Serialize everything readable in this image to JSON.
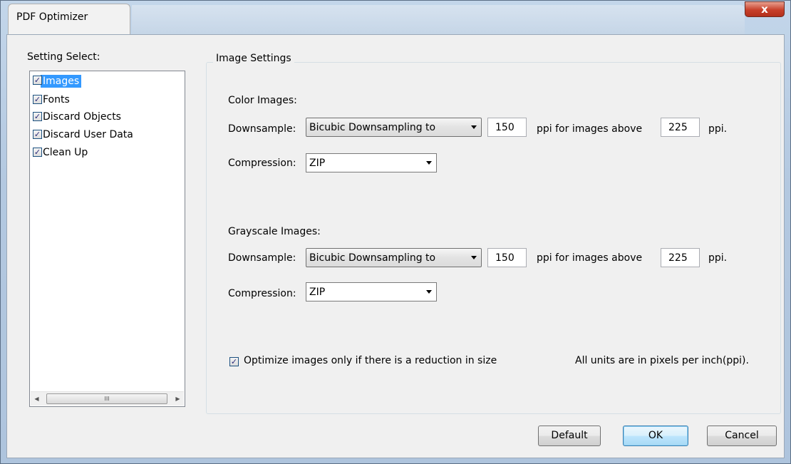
{
  "window": {
    "title": "PDF Optimizer",
    "close_symbol": "x"
  },
  "settings": {
    "header": "Setting Select:",
    "items": [
      {
        "label": "Images",
        "checked": true,
        "selected": true
      },
      {
        "label": "Fonts",
        "checked": true,
        "selected": false
      },
      {
        "label": "Discard Objects",
        "checked": true,
        "selected": false
      },
      {
        "label": "Discard User Data",
        "checked": true,
        "selected": false
      },
      {
        "label": "Clean Up",
        "checked": true,
        "selected": false
      }
    ],
    "scroll_grip": "III"
  },
  "image_settings": {
    "title": "Image Settings",
    "color": {
      "heading": "Color Images:",
      "downsample_label": "Downsample:",
      "downsample_value": "Bicubic Downsampling to",
      "ppi_value": "150",
      "above_label": "ppi for images above",
      "above_value": "225",
      "unit": "ppi.",
      "compression_label": "Compression:",
      "compression_value": "ZIP"
    },
    "grayscale": {
      "heading": "Grayscale Images:",
      "downsample_label": "Downsample:",
      "downsample_value": "Bicubic Downsampling to",
      "ppi_value": "150",
      "above_label": "ppi for images above",
      "above_value": "225",
      "unit": "ppi.",
      "compression_label": "Compression:",
      "compression_value": "ZIP"
    },
    "optimize_checkbox_label": "Optimize images only if there is a reduction in size",
    "optimize_checked": true,
    "units_note": "All units are in pixels per inch(ppi)."
  },
  "buttons": {
    "default": "Default",
    "ok": "OK",
    "cancel": "Cancel"
  }
}
